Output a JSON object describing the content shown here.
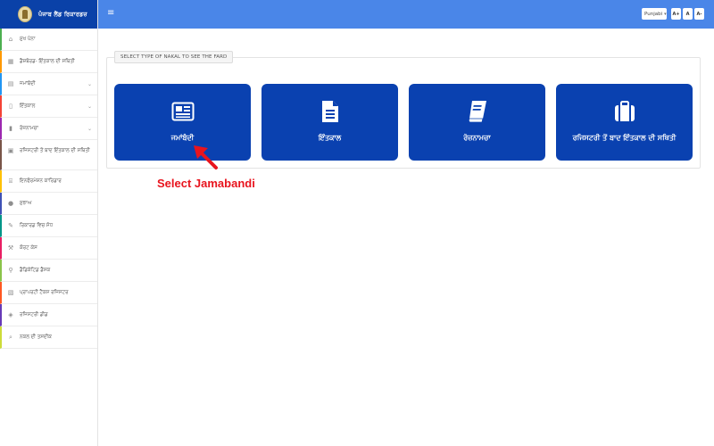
{
  "brand": {
    "title": "ਪੰਜਾਬ ਲੈਂਡ ਰਿਕਾਰਡਜ਼"
  },
  "sidebar": {
    "items": [
      {
        "label": "ਮੁੱਖ ਪੰਨਾ",
        "icon": "home-icon",
        "accent": "#4caf50"
      },
      {
        "label": "ਡੈਸ਼ਬੋਰਡ- ਇੰਤਕਾਲ ਦੀ ਸਥਿਤੀ",
        "icon": "dashboard-icon",
        "accent": "#ff9800"
      },
      {
        "label": "ਜਮਾਂਬੰਦੀ",
        "icon": "document-icon",
        "accent": "#2196f3",
        "chevron": "⌄"
      },
      {
        "label": "ਇੰਤਕਾਲ",
        "icon": "file-icon",
        "accent": "#f44336",
        "chevron": "⌄"
      },
      {
        "label": "ਰੋਜ਼ਨਾਮਚਾ",
        "icon": "book-icon",
        "accent": "#9c27b0",
        "chevron": "⌄"
      },
      {
        "label": "ਰਜਿਸਟਰੀ ਤੋਂ ਬਾਦ ਇੰਤਕਾਲ ਦੀ ਸਥਿਤੀ",
        "icon": "suitcase-icon",
        "accent": "#795548"
      },
      {
        "label": "ਇਨਫੋਰਮੇਸ਼ਨ ਕਾਰਿਡਾਰ",
        "icon": "bank-icon",
        "accent": "#ffc107"
      },
      {
        "label": "ਸੁਝਾਅ",
        "icon": "comment-icon",
        "accent": "#3f51b5"
      },
      {
        "label": "ਰਿਕਾਰਡ ਵਿਚ ਸੋਧ",
        "icon": "edit-icon",
        "accent": "#009688"
      },
      {
        "label": "ਕੋਰਟ ਕੇਸ",
        "icon": "gavel-icon",
        "accent": "#e91e63"
      },
      {
        "label": "ਡੈਡਿਕੇਟਿਡ ਡੈਸਕ",
        "icon": "pin-icon",
        "accent": "#8bc34a"
      },
      {
        "label": "ਪ੍ਰਾਪਰਟੀ ਟੈਕਸ ਰਜਿਸਟਰ",
        "icon": "register-icon",
        "accent": "#ff5722"
      },
      {
        "label": "ਰਜਿਸਟਰੀ ਡੀਡ",
        "icon": "deed-icon",
        "accent": "#673ab7"
      },
      {
        "label": "ਨਕਲ ਦੀ ਤਸਦੀਕ",
        "icon": "search-icon",
        "accent": "#cddc39"
      }
    ]
  },
  "topbar": {
    "menu_glyph": "≡",
    "language": "Punjabi",
    "caret": "▾",
    "font_buttons": [
      "A+",
      "A",
      "A-"
    ]
  },
  "main": {
    "legend": "SELECT TYPE OF NAKAL TO SEE THE FARD",
    "cards": [
      {
        "label": "ਜਮਾਂਬੰਦੀ",
        "icon": "newspaper-icon"
      },
      {
        "label": "ਇੰਤਕਾਲ",
        "icon": "file-text-icon"
      },
      {
        "label": "ਰੋਜ਼ਨਾਮਚਾ",
        "icon": "book-icon"
      },
      {
        "label": "ਰਜਿਸਟਰੀ ਤੋਂ ਬਾਦ ਇੰਤਕਾਲ ਦੀ ਸਥਿਤੀ",
        "icon": "suitcase-icon"
      }
    ]
  },
  "annotation": {
    "text": "Select Jamabandi",
    "color": "#e8141e"
  },
  "colors": {
    "brand_bg": "#0a41a8",
    "topbar_bg": "#4a86e8",
    "card_bg": "#0a41b0"
  }
}
